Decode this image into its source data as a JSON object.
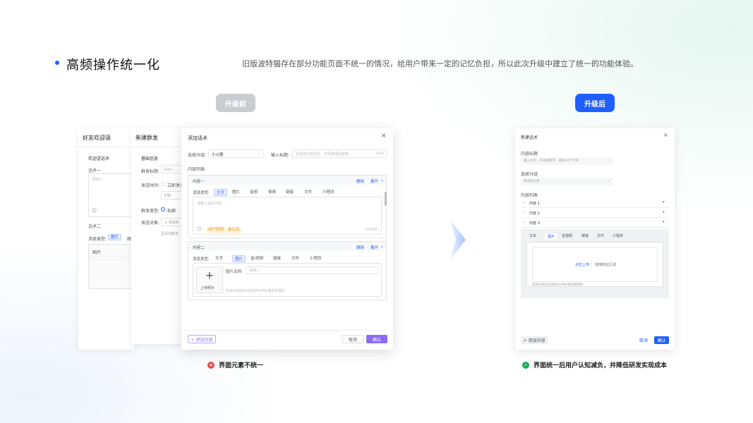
{
  "heading": {
    "title": "高频操作统一化",
    "description": "旧版波特猫存在部分功能页面不统一的情况，给用户带来一定的记忆负担，所以此次升级中建立了统一的功能体验。"
  },
  "before": {
    "label": "升级前",
    "caption": "界面元素不统一",
    "friend": {
      "title": "好友欢迎语",
      "section": "欢迎语话术",
      "script1": "话术一",
      "placeholder": "请输入",
      "script2": "话术二",
      "msg_type": "消息类型:",
      "msg_type_val": "图片",
      "img_label": "图片"
    },
    "group": {
      "title": "新建群发",
      "section": "基础信息",
      "send_title": "群发标题:",
      "send_title_ph": "请输入...",
      "send_time": "发送时间:",
      "send_now": "立即发送",
      "date": "日期",
      "group_type": "群发类型:",
      "private": "私聊",
      "target": "发送对象:",
      "add_btn": "+ 添加对",
      "hint": "因添加群发"
    },
    "dialog": {
      "title": "添加话术",
      "group_label": "选择分组:",
      "group_value": "小火箭",
      "input_title": "输入标题:",
      "input_ph": "标题仅内部可见，方便整理和搜索",
      "counter1": "0/30",
      "content_list": "内容列表:",
      "item1": {
        "label": "内容一",
        "delete": "删除",
        "expand": "展开"
      },
      "msg_type": "消息类型:",
      "tabs1": [
        "文字",
        "图片",
        "音频",
        "视频",
        "链接",
        "文件",
        "小程序"
      ],
      "text_ph": "请输入话术内容",
      "tag_user": "用户昵称",
      "tag_remark": "备注名",
      "counter2": "0/2000",
      "item2": {
        "label": "内容二",
        "delete": "删除",
        "expand": "展开"
      },
      "tabs2": [
        "文字",
        "图片",
        "音/视频",
        "链接",
        "文件",
        "小程序"
      ],
      "upload": "上传照片",
      "img_name": "图片名称:",
      "img_name_ph": "请输入",
      "img_hint": "支持20MB以内的JPG/PNG格式的图片",
      "add_content": "+ 添加内容",
      "cancel": "取消",
      "confirm": "确认"
    }
  },
  "after": {
    "label": "升级后",
    "caption": "界面统一后用户认知减负，并降低研发实现成本",
    "dialog": {
      "title": "新建话术",
      "content_title": "内容标题",
      "content_ph": "输入文字、字母或数字，最多20个字符",
      "group_label": "选择分组",
      "group_ph": "请选择分组",
      "list_label": "内容列表",
      "items": [
        "内容 1",
        "内容 2",
        "内容 3"
      ],
      "tabs": [
        "文本",
        "图片",
        "音视频",
        "链接",
        "文件",
        "小程序"
      ],
      "upload_link": "点击上传",
      "upload_sep": "/",
      "upload_drag": "拖拽到此区域",
      "upload_hint": "支持20M以内的JPG/PNG格式的图片",
      "add_content": "+ 添加内容",
      "cancel": "取消",
      "confirm": "确认"
    }
  },
  "colors": {
    "accent": "#1f5fff",
    "purple": "#8b6cf0",
    "green": "#1aaa55",
    "red": "#e84a4a",
    "gray_pill": "#c9ccd1"
  }
}
